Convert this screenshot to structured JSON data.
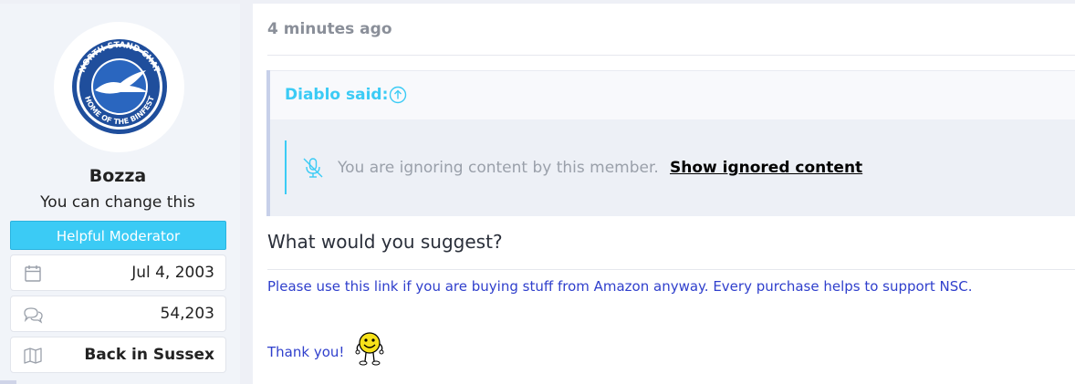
{
  "sidebar": {
    "avatar_label": "North Stand Chat avatar",
    "avatar_text_top": "NORTH STAND CHAT",
    "avatar_text_bottom": "HOME OF THE BINFEST",
    "username": "Bozza",
    "user_title": "You can change this",
    "banner": "Helpful Moderator",
    "stats": [
      {
        "icon": "calendar-icon",
        "value": "Jul 4, 2003"
      },
      {
        "icon": "comments-icon",
        "value": "54,203"
      },
      {
        "icon": "map-icon",
        "value": "Back in Sussex"
      }
    ]
  },
  "post": {
    "timestamp": "4 minutes ago",
    "quote": {
      "author_label": "Diablo said:",
      "ignored_text": "You are ignoring content by this member.",
      "ignored_link": "Show ignored content"
    },
    "message": "What would you suggest?",
    "signature": {
      "line1": "Please use this link if you are buying stuff from Amazon anyway. Every purchase helps to support NSC.",
      "line2": "Thank you!"
    }
  },
  "colors": {
    "accent": "#3bcbf5",
    "signature": "#2f3fcc",
    "sidebar_bg": "#f1f4f9"
  }
}
